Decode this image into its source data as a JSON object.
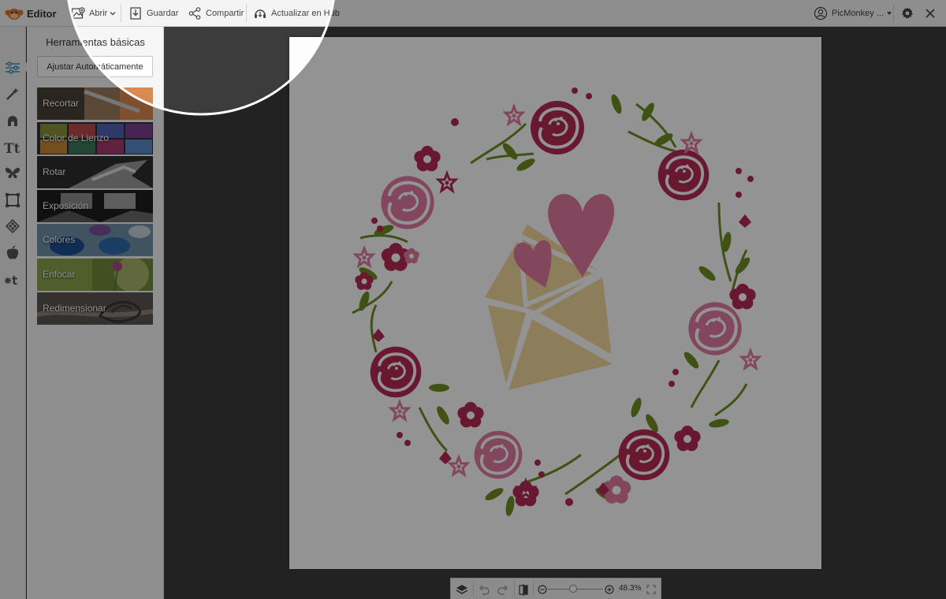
{
  "topbar": {
    "app_name": "Editor",
    "open_label": "Abrir",
    "save_label": "Guardar",
    "share_label": "Compartir",
    "hub_label": "Actualizar en Hub",
    "account_label": "PicMonkey ..."
  },
  "panel": {
    "title": "Herramientas básicas",
    "auto_adjust_label": "Ajustar Automáticamente",
    "tools": [
      {
        "label": "Recortar"
      },
      {
        "label": "Color de Lienzo"
      },
      {
        "label": "Rotar"
      },
      {
        "label": "Exposición"
      },
      {
        "label": "Colores"
      },
      {
        "label": "Enfocar"
      },
      {
        "label": "Redimensionar"
      }
    ]
  },
  "rail": {
    "icons": [
      "sliders-icon",
      "magic-wand-icon",
      "touch-up-face-icon",
      "text-icon",
      "overlays-butterfly-icon",
      "frames-icon",
      "textures-icon",
      "themes-apple-icon",
      "seasonal-icon"
    ]
  },
  "bottombar": {
    "zoom": "48.3%",
    "zoom_fraction": 0.45
  },
  "colors": {
    "accent": "#2f8fbf",
    "logo": "#e2762e",
    "dark_rose": "#b52a55",
    "pink": "#e07aa1",
    "leaf": "#6e8e22",
    "envelope": "#f2d79e"
  }
}
